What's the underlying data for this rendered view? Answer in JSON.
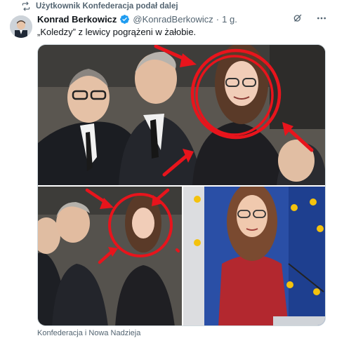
{
  "repost": {
    "label": "Użytkownik Konfederacja podał dalej"
  },
  "tweet": {
    "author_name": "Konrad Berkowicz",
    "handle": "@KonradBerkowicz",
    "separator": "·",
    "time": "1 g.",
    "text": "„Koledzy” z lewicy pogrążeni w żałobie."
  },
  "media": {
    "caption": "Konfederacja i Nowa Nadzieja"
  },
  "icons": {
    "repost": "repost-icon",
    "verified": "verified-badge-icon",
    "grok": "grok-icon",
    "more": "more-icon"
  },
  "colors": {
    "accent": "#1d9bf0",
    "annotation_red": "#e8141c",
    "muted_text": "#536471"
  }
}
